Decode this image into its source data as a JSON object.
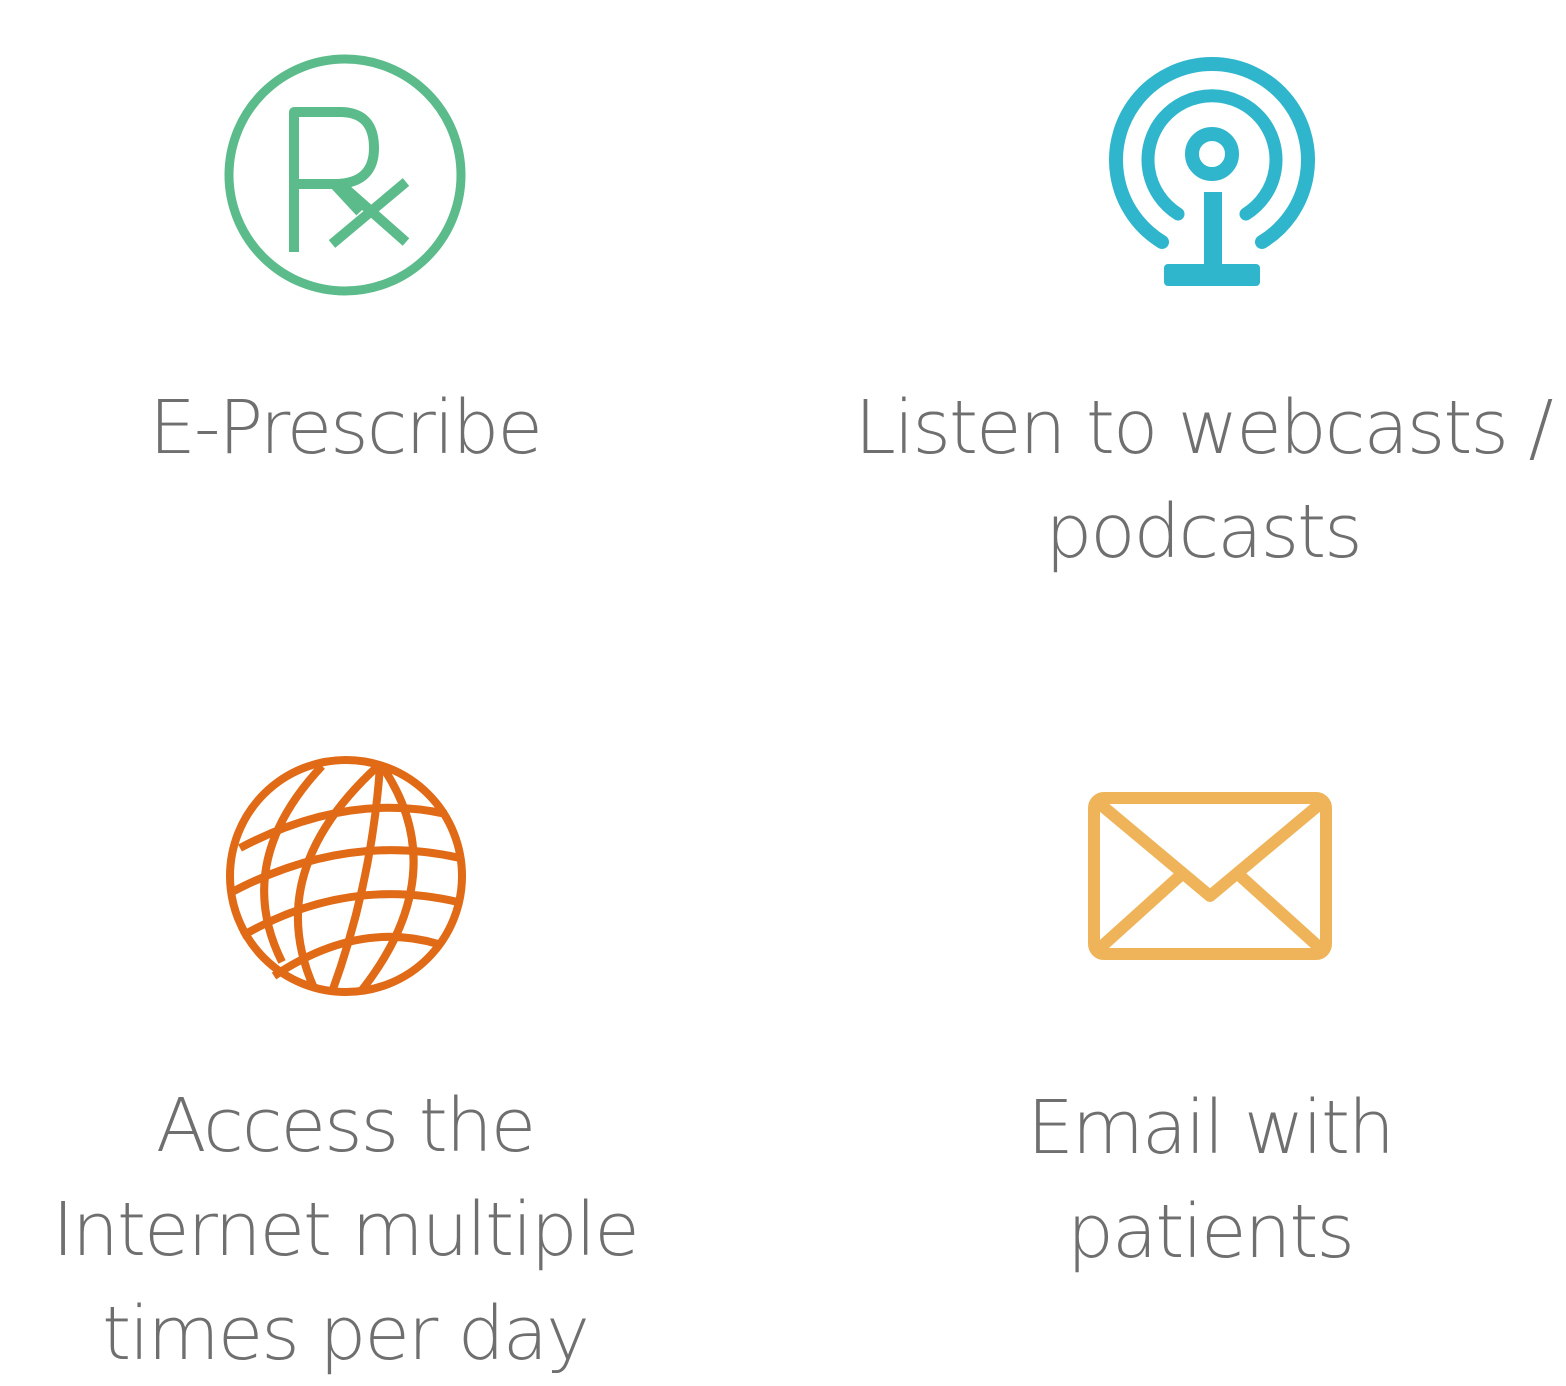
{
  "features": [
    {
      "label_lines": [
        "E-Prescribe"
      ],
      "icon": "rx-icon",
      "color": "#5bbb8a"
    },
    {
      "label_lines": [
        "Listen to webcasts /",
        "podcasts"
      ],
      "icon": "broadcast-tower-icon",
      "color": "#2fb6cc"
    },
    {
      "label_lines": [
        "Access the",
        "Internet multiple",
        "times per day"
      ],
      "icon": "globe-icon",
      "color": "#e06a16"
    },
    {
      "label_lines": [
        "Email with",
        "patients"
      ],
      "icon": "envelope-icon",
      "color": "#efb45a"
    }
  ]
}
